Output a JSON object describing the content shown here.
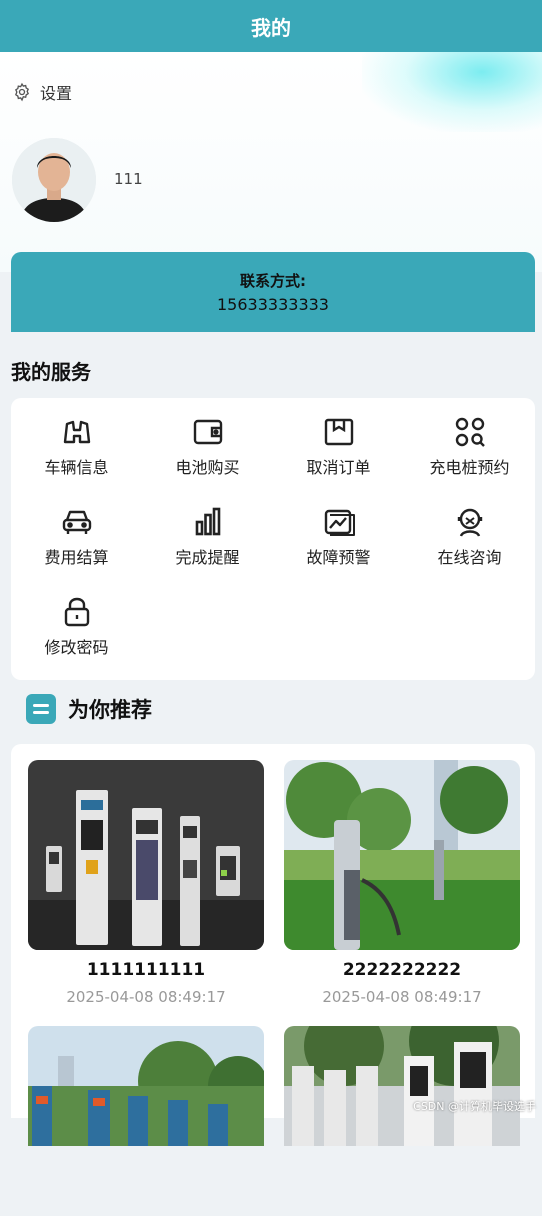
{
  "header": {
    "title": "我的"
  },
  "settings": {
    "label": "设置",
    "icon": "gear-icon"
  },
  "profile": {
    "username": "111"
  },
  "contact": {
    "label": "联系方式:",
    "phone": "15633333333",
    "color": "#3aa8b8"
  },
  "services": {
    "title": "我的服务",
    "items": [
      {
        "label": "车辆信息",
        "icon": "binoculars-icon"
      },
      {
        "label": "电池购买",
        "icon": "wallet-icon"
      },
      {
        "label": "取消订单",
        "icon": "box-icon"
      },
      {
        "label": "充电桩预约",
        "icon": "grid-search-icon"
      },
      {
        "label": "费用结算",
        "icon": "car-icon"
      },
      {
        "label": "完成提醒",
        "icon": "bar-chart-icon"
      },
      {
        "label": "故障预警",
        "icon": "picture-chart-icon"
      },
      {
        "label": "在线咨询",
        "icon": "support-agent-icon"
      },
      {
        "label": "修改密码",
        "icon": "lock-icon"
      }
    ]
  },
  "recommend": {
    "title": "为你推荐",
    "cards": [
      {
        "name": "1111111111",
        "date": "2025-04-08 08:49:17"
      },
      {
        "name": "2222222222",
        "date": "2025-04-08 08:49:17"
      }
    ]
  },
  "watermark": "CSDN @计算机毕设选手"
}
